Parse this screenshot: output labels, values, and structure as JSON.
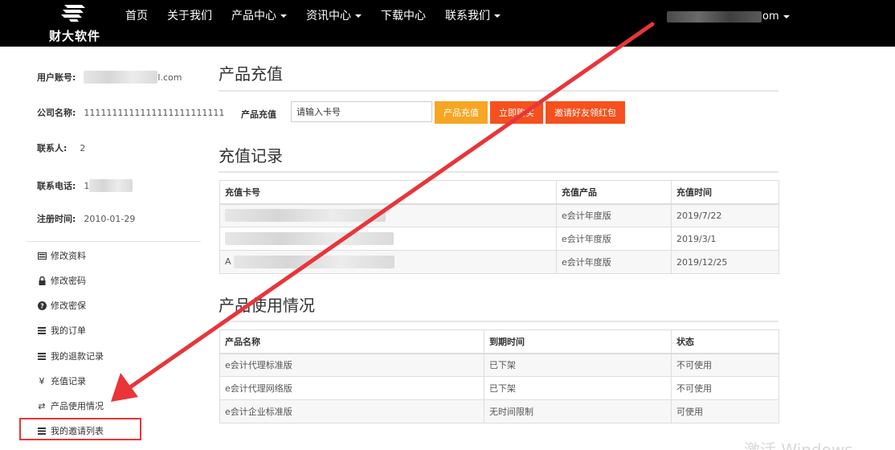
{
  "brand": {
    "name": "财大软件"
  },
  "nav": {
    "items": [
      {
        "label": "首页",
        "dropdown": false
      },
      {
        "label": "关于我们",
        "dropdown": false
      },
      {
        "label": "产品中心",
        "dropdown": true
      },
      {
        "label": "资讯中心",
        "dropdown": true
      },
      {
        "label": "下载中心",
        "dropdown": false
      },
      {
        "label": "联系我们",
        "dropdown": true
      }
    ],
    "user_suffix": "om"
  },
  "profile": {
    "account_label": "用户账号:",
    "account_suffix": "l.com",
    "company_label": "公司名称:",
    "company_value": "1111111111111111111111111",
    "contact_label": "联系人:",
    "contact_value": "2",
    "phone_label": "联系电话:",
    "phone_prefix": "1",
    "register_label": "注册时间:",
    "register_value": "2010-01-29"
  },
  "menu": {
    "items": [
      {
        "label": "修改资料",
        "icon": "id-card-icon",
        "glyph": "▬"
      },
      {
        "label": "修改密码",
        "icon": "lock-icon",
        "glyph": "🔒"
      },
      {
        "label": "修改密保",
        "icon": "question-circle-icon",
        "glyph": "❓"
      },
      {
        "label": "我的订单",
        "icon": "list-icon",
        "glyph": "≡"
      },
      {
        "label": "我的退款记录",
        "icon": "list-icon",
        "glyph": "≡"
      },
      {
        "label": "充值记录",
        "icon": "yen-icon",
        "glyph": "¥"
      },
      {
        "label": "产品使用情况",
        "icon": "exchange-icon",
        "glyph": "⇄"
      },
      {
        "label": "我的邀请列表",
        "icon": "list-icon",
        "glyph": "≡"
      }
    ]
  },
  "recharge": {
    "title": "产品充值",
    "label": "产品充值",
    "input_placeholder": "请输入卡号",
    "recharge_button": "产品充值",
    "buy_button": "立即购买",
    "invite_button": "邀请好友领红包"
  },
  "records": {
    "title": "充值记录",
    "columns": [
      "充值卡号",
      "充值产品",
      "充值时间"
    ],
    "rows": [
      {
        "card": "",
        "product": "e会计年度版",
        "date": "2019/7/22"
      },
      {
        "card": "",
        "product": "e会计年度版",
        "date": "2019/3/1"
      },
      {
        "card": "A",
        "product": "e会计年度版",
        "date": "2019/12/25"
      }
    ]
  },
  "usage": {
    "title": "产品使用情况",
    "columns": [
      "产品名称",
      "到期时间",
      "状态"
    ],
    "rows": [
      {
        "name": "e会计代理标准版",
        "expiry": "已下架",
        "status": "不可使用"
      },
      {
        "name": "e会计代理网络版",
        "expiry": "已下架",
        "status": "不可使用"
      },
      {
        "name": "e会计企业标准版",
        "expiry": "无时间限制",
        "status": "可使用"
      }
    ]
  },
  "watermark": "激活 Windows",
  "colors": {
    "topbar": "#000000",
    "btn_recharge": "#f6a623",
    "btn_buy": "#f5501d",
    "annotation": "#e8353a"
  }
}
